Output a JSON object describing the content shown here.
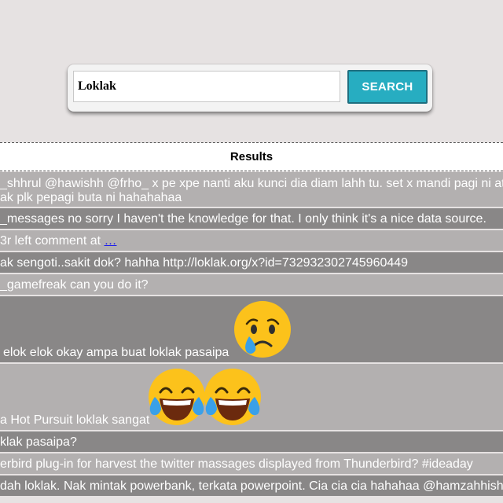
{
  "search": {
    "value": "Loklak",
    "button_label": "SEARCH"
  },
  "results": {
    "header": "Results",
    "rows": [
      {
        "line1": "_shhrul @hawishh @frho_ x pe xpe nanti aku kunci dia diam lahh tu. set x mandi pagi ni aty",
        "line2": "ak plk pepagi buta ni hahahahaa"
      },
      {
        "text": "_messages no sorry I haven't the knowledge for that. I only think it's a nice data source."
      },
      {
        "text": "3r left comment at",
        "link": "…"
      },
      {
        "text": "ak sengoti..sakit dok? hahha http://loklak.org/x?id=732932302745960449"
      },
      {
        "text": "_gamefreak can you do it?"
      },
      {
        "text": "elok elok okay ampa buat loklak pasaipa",
        "emoji": "crying-face"
      },
      {
        "text": "a Hot Pursuit loklak sangat",
        "emoji": "tears-of-joy-face"
      },
      {
        "text": "klak pasaipa?"
      },
      {
        "text": "erbird plug-in for harvest the twitter massages displayed from Thunderbird? #ideaday"
      },
      {
        "text": "dah loklak. Nak mintak powerbank, terkata powerpoint. Cia cia cia hahahaa @hamzahhisham"
      }
    ]
  },
  "colors": {
    "background": "#e6e2e2",
    "accent": "#27adc1",
    "row_light": "#b3b0b0",
    "row_dark": "#898787"
  }
}
